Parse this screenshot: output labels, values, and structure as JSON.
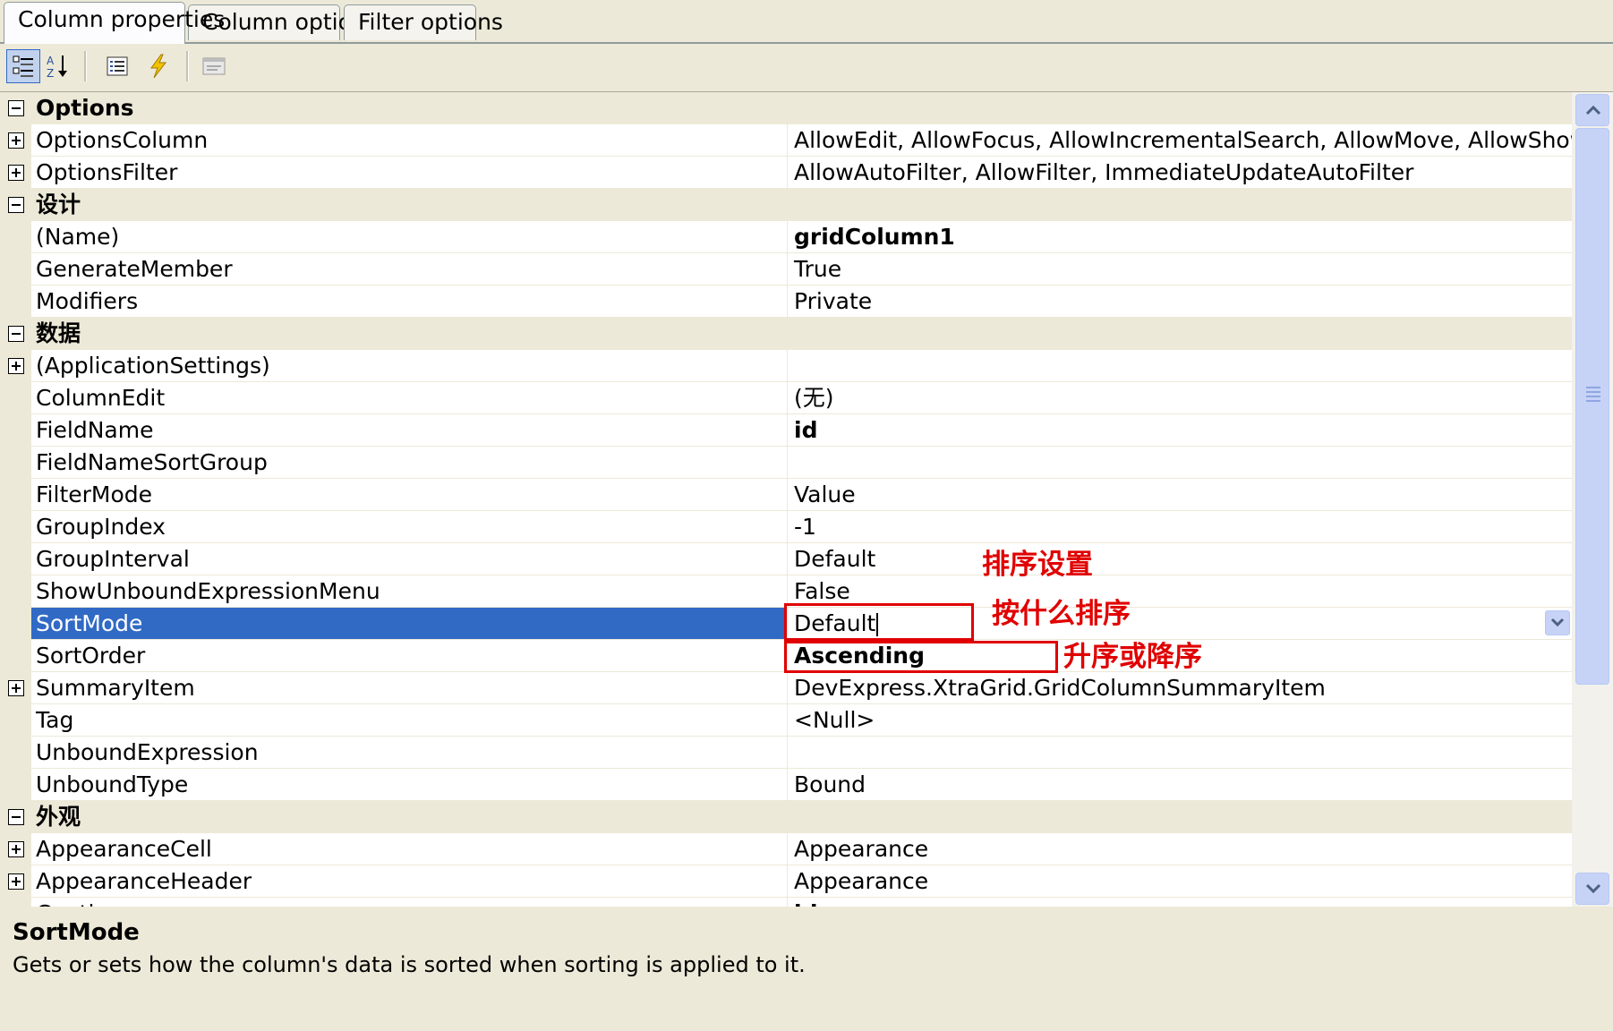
{
  "tabs": [
    {
      "label": "Column properties",
      "active": true
    },
    {
      "label": "Column options",
      "active": false
    },
    {
      "label": "Filter options",
      "active": false
    }
  ],
  "toolbar": {
    "buttons": [
      {
        "name": "categorized-view-icon",
        "pressed": true
      },
      {
        "name": "alphabetical-sort-icon",
        "pressed": false
      },
      {
        "name": "properties-list-icon",
        "pressed": false
      },
      {
        "name": "events-lightning-icon",
        "pressed": false
      },
      {
        "name": "property-pages-icon",
        "pressed": false
      }
    ]
  },
  "grid": {
    "rows": [
      {
        "type": "category",
        "label": "Options"
      },
      {
        "type": "prop",
        "name": "OptionsColumn",
        "value": "AllowEdit, AllowFocus, AllowIncrementalSearch, AllowMove, AllowShowHide, All",
        "expandable": true
      },
      {
        "type": "prop",
        "name": "OptionsFilter",
        "value": "AllowAutoFilter, AllowFilter, ImmediateUpdateAutoFilter",
        "expandable": true
      },
      {
        "type": "category",
        "label": "设计"
      },
      {
        "type": "prop",
        "name": "(Name)",
        "value": "gridColumn1",
        "bold": true
      },
      {
        "type": "prop",
        "name": "GenerateMember",
        "value": "True"
      },
      {
        "type": "prop",
        "name": "Modifiers",
        "value": "Private"
      },
      {
        "type": "category",
        "label": "数据"
      },
      {
        "type": "prop",
        "name": "(ApplicationSettings)",
        "value": "",
        "expandable": true
      },
      {
        "type": "prop",
        "name": "ColumnEdit",
        "value": "(无)"
      },
      {
        "type": "prop",
        "name": "FieldName",
        "value": "id",
        "bold": true
      },
      {
        "type": "prop",
        "name": "FieldNameSortGroup",
        "value": ""
      },
      {
        "type": "prop",
        "name": "FilterMode",
        "value": "Value"
      },
      {
        "type": "prop",
        "name": "GroupIndex",
        "value": "-1"
      },
      {
        "type": "prop",
        "name": "GroupInterval",
        "value": "Default"
      },
      {
        "type": "prop",
        "name": "ShowUnboundExpressionMenu",
        "value": "False"
      },
      {
        "type": "prop",
        "name": "SortMode",
        "value": "Default",
        "selected": true,
        "editing": true
      },
      {
        "type": "prop",
        "name": "SortOrder",
        "value": "Ascending",
        "bold": true
      },
      {
        "type": "prop",
        "name": "SummaryItem",
        "value": "DevExpress.XtraGrid.GridColumnSummaryItem",
        "expandable": true
      },
      {
        "type": "prop",
        "name": "Tag",
        "value": "<Null>"
      },
      {
        "type": "prop",
        "name": "UnboundExpression",
        "value": ""
      },
      {
        "type": "prop",
        "name": "UnboundType",
        "value": "Bound"
      },
      {
        "type": "category",
        "label": "外观"
      },
      {
        "type": "prop",
        "name": "AppearanceCell",
        "value": "Appearance",
        "expandable": true
      },
      {
        "type": "prop",
        "name": "AppearanceHeader",
        "value": "Appearance",
        "expandable": true
      },
      {
        "type": "prop",
        "name": "Caption",
        "value": "id",
        "bold": true
      }
    ]
  },
  "annotations": {
    "sort_settings": "排序设置",
    "sort_by_what": "按什么排序",
    "asc_or_desc": "升序或降序"
  },
  "description": {
    "title": "SortMode",
    "text": "Gets or sets how the column's data is sorted when sorting is applied to it."
  },
  "colors": {
    "selected_row": "#316ac5",
    "annotation": "#e00000",
    "category_bg": "#ece9d8",
    "scrollbar": "#c6d3f7"
  }
}
